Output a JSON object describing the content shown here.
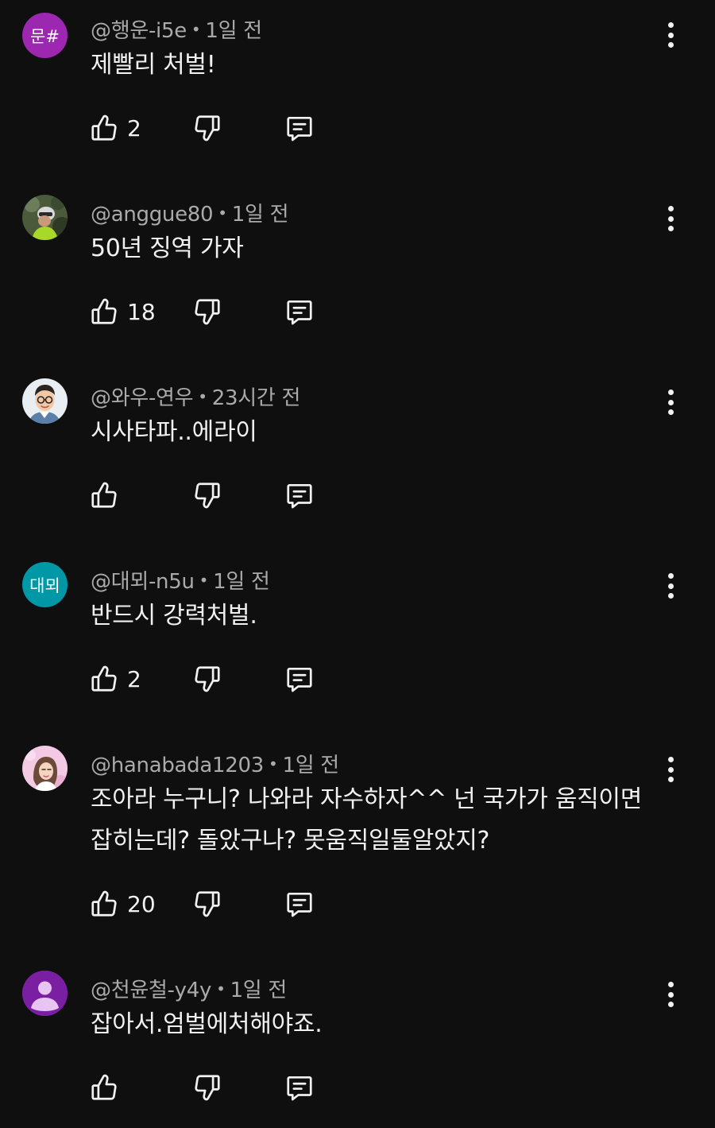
{
  "comments": [
    {
      "author": "@행운-i5e",
      "time": "1일 전",
      "text": "제빨리 처벌!",
      "likes": "2",
      "avatar": {
        "kind": "initials",
        "initials": "문#",
        "bg": "#9c27b0"
      }
    },
    {
      "author": "@anggue80",
      "time": "1일 전",
      "text": "50년 징역 가자",
      "likes": "18",
      "avatar": {
        "kind": "photo",
        "icon": "cyclist-photo-avatar"
      }
    },
    {
      "author": "@와우-연우",
      "time": "23시간 전",
      "text": "시사타파..에라이",
      "likes": "",
      "avatar": {
        "kind": "photo",
        "icon": "cartoon-man-glasses-avatar"
      }
    },
    {
      "author": "@대뫼-n5u",
      "time": "1일 전",
      "text": "반드시 강력처벌.",
      "likes": "2",
      "avatar": {
        "kind": "initials",
        "initials": "대뫼",
        "bg": "#0097a7"
      }
    },
    {
      "author": "@hanabada1203",
      "time": "1일 전",
      "text": "조아라 누구니? 나와라 자수하자^^  넌 국가가 움직이면 잡히는데? 돌았구나? 못움직일둘알았지?",
      "likes": "20",
      "avatar": {
        "kind": "photo",
        "icon": "woman-pink-avatar"
      }
    },
    {
      "author": "@천윤철-y4y",
      "time": "1일 전",
      "text": "잡아서.엄벌에처해야죠.",
      "likes": "",
      "avatar": {
        "kind": "default",
        "icon": "default-user-avatar",
        "bg": "#7b1fa2"
      }
    }
  ],
  "ui": {
    "separator": "•",
    "icons": {
      "like": "thumbs-up-icon",
      "dislike": "thumbs-down-icon",
      "reply": "reply-comment-icon",
      "more": "more-vert-icon"
    }
  },
  "colors": {
    "background": "#0f0f0f",
    "text": "#f1f1f1",
    "meta": "#aaaaaa"
  }
}
